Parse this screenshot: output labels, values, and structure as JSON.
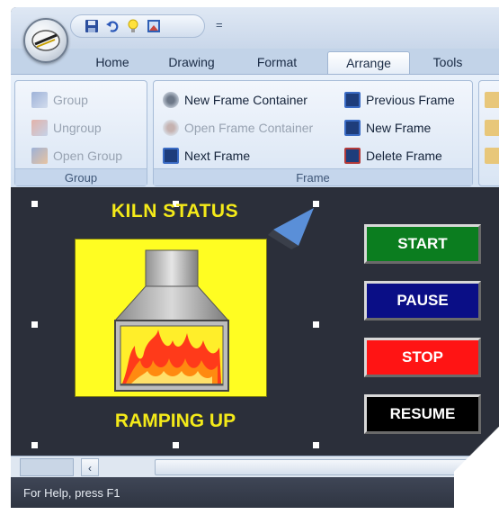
{
  "quick_access": {
    "icons": [
      "save-icon",
      "undo-icon",
      "lightbulb-icon",
      "picture-icon"
    ],
    "more_glyph": "="
  },
  "tabs": [
    {
      "label": "Home",
      "active": false
    },
    {
      "label": "Drawing",
      "active": false
    },
    {
      "label": "Format",
      "active": false
    },
    {
      "label": "Arrange",
      "active": true
    },
    {
      "label": "Tools",
      "active": false
    }
  ],
  "ribbon": {
    "group_section": {
      "label": "Group",
      "buttons": [
        {
          "label": "Group",
          "icon": "group-icon",
          "enabled": false
        },
        {
          "label": "Ungroup",
          "icon": "ungroup-icon",
          "enabled": false
        },
        {
          "label": "Open Group",
          "icon": "open-group-icon",
          "enabled": false
        }
      ]
    },
    "frame_section": {
      "label": "Frame",
      "buttons": [
        {
          "label": "New Frame Container",
          "icon": "frame-container-icon",
          "enabled": true
        },
        {
          "label": "Open Frame Container",
          "icon": "open-frame-container-icon",
          "enabled": false
        },
        {
          "label": "Next Frame",
          "icon": "next-frame-icon",
          "enabled": true
        },
        {
          "label": "Previous Frame",
          "icon": "previous-frame-icon",
          "enabled": true
        },
        {
          "label": "New Frame",
          "icon": "new-frame-icon",
          "enabled": true
        },
        {
          "label": "Delete Frame",
          "icon": "delete-frame-icon",
          "enabled": true
        }
      ]
    }
  },
  "canvas": {
    "title": "KILN STATUS",
    "status": "RAMPING UP",
    "buttons": [
      {
        "label": "START",
        "color": "#0b7d1f"
      },
      {
        "label": "PAUSE",
        "color": "#0a0e86"
      },
      {
        "label": "STOP",
        "color": "#ff1414"
      },
      {
        "label": "RESUME",
        "color": "#000000"
      }
    ]
  },
  "scrollbar": {
    "left_arrow": "‹"
  },
  "status_bar": {
    "text": "For Help, press F1"
  }
}
